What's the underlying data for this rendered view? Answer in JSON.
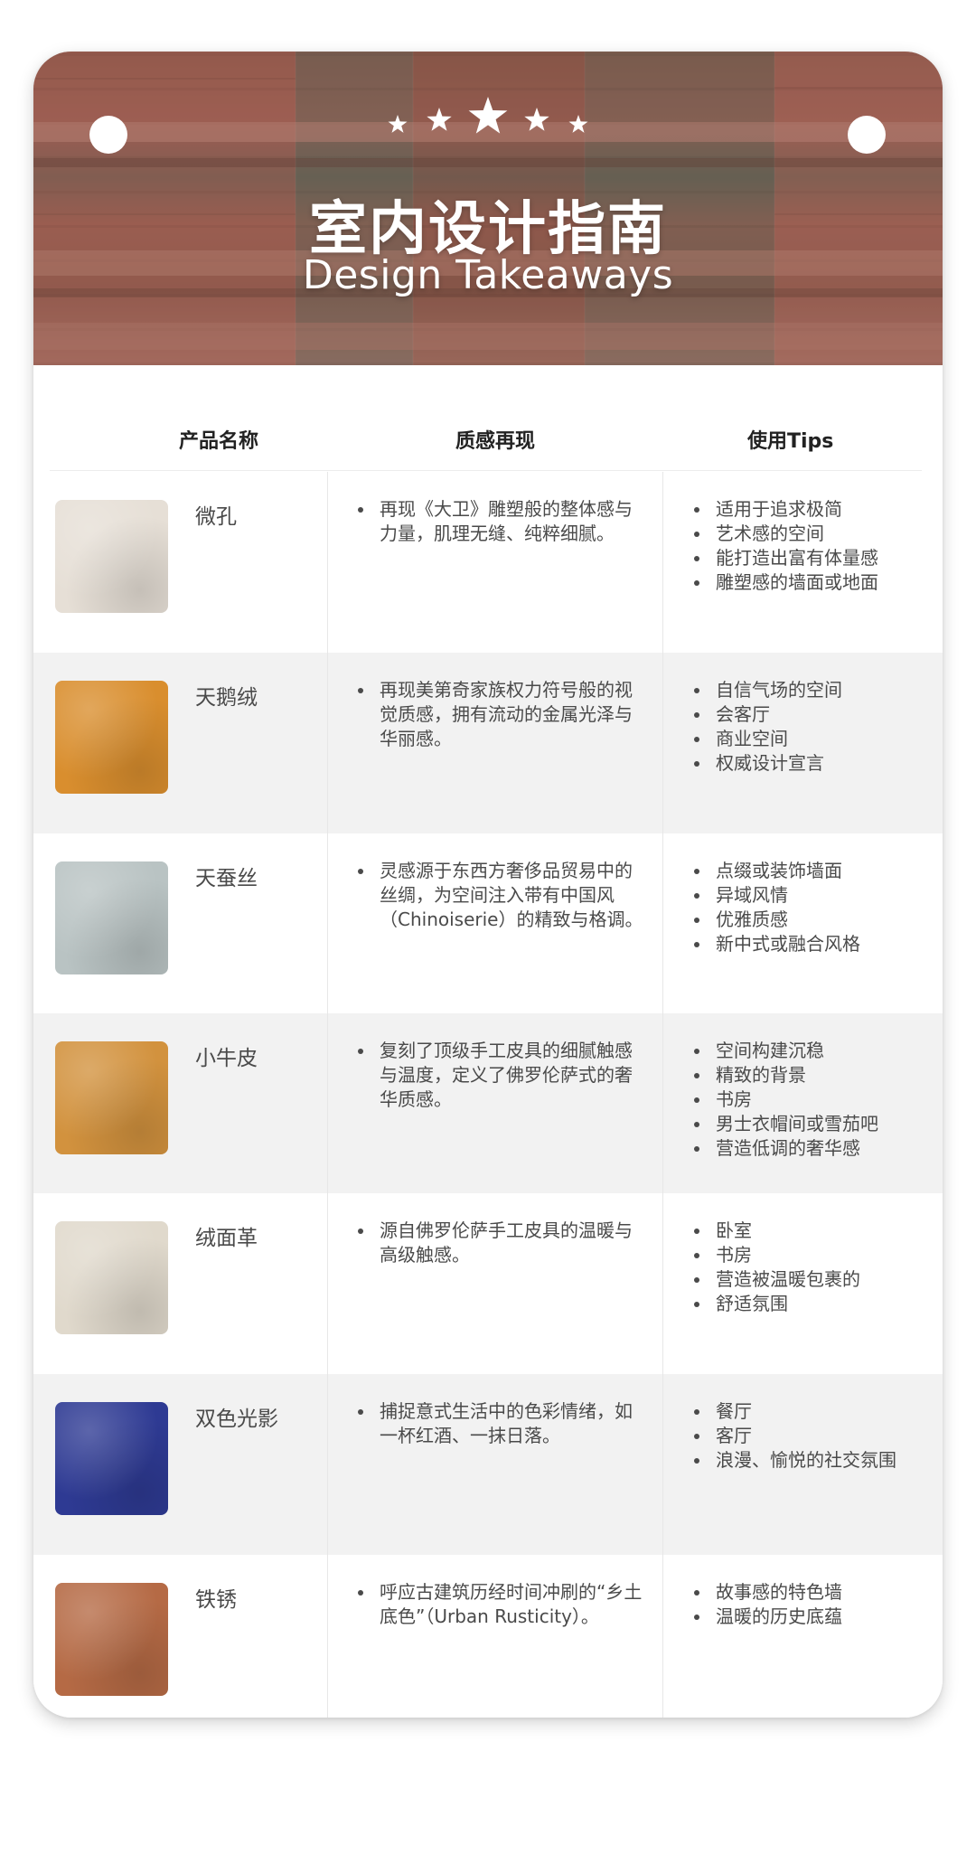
{
  "header": {
    "title_cn": "室内设计指南",
    "title_en": "Design Takeaways",
    "stars_icon": "five-stars-icon"
  },
  "table": {
    "headers": {
      "product": "产品名称",
      "quality": "质感再现",
      "tips": "使用Tips"
    },
    "rows": [
      {
        "name": "微孔",
        "swatch": "#e6dfd6",
        "quality": [
          "再现《大卫》雕塑般的整体感与力量，肌理无缝、纯粹细腻。"
        ],
        "tips": [
          "适用于追求极简",
          "艺术感的空间",
          "能打造出富有体量感",
          "雕塑感的墙面或地面"
        ]
      },
      {
        "name": "天鹅绒",
        "swatch": "#d98e2e",
        "quality": [
          "再现美第奇家族权力符号般的视觉质感，拥有流动的金属光泽与华丽感。"
        ],
        "tips": [
          "自信气场的空间",
          "会客厅",
          "商业空间",
          "权威设计宣言"
        ]
      },
      {
        "name": "天蚕丝",
        "swatch": "#b9c3c3",
        "quality": [
          "灵感源于东西方奢侈品贸易中的丝绸，为空间注入带有中国风（Chinoiserie）的精致与格调。"
        ],
        "tips": [
          "点缀或装饰墙面",
          "异域风情",
          "优雅质感",
          "新中式或融合风格"
        ]
      },
      {
        "name": "小牛皮",
        "swatch": "#d2923e",
        "quality": [
          "复刻了顶级手工皮具的细腻触感与温度，定义了佛罗伦萨式的奢华质感。"
        ],
        "tips": [
          "空间构建沉稳",
          "精致的背景",
          "书房",
          "男士衣帽间或雪茄吧",
          "营造低调的奢华感"
        ]
      },
      {
        "name": "绒面革",
        "swatch": "#e0d9cc",
        "quality": [
          "源自佛罗伦萨手工皮具的温暖与高级触感。"
        ],
        "tips": [
          "卧室",
          "书房",
          "营造被温暖包裹的",
          "舒适氛围"
        ]
      },
      {
        "name": "双色光影",
        "swatch": "#2e3a93",
        "quality": [
          "捕捉意式生活中的色彩情绪，如一杯红酒、一抹日落。"
        ],
        "tips": [
          "餐厅",
          "客厅",
          "浪漫、愉悦的社交氛围"
        ]
      },
      {
        "name": "铁锈",
        "swatch": "#b56a45",
        "quality": [
          "呼应古建筑历经时间冲刷的“乡土底色”（Urban Rusticity）。"
        ],
        "tips": [
          "故事感的特色墙",
          "温暖的历史底蕴"
        ]
      }
    ]
  }
}
